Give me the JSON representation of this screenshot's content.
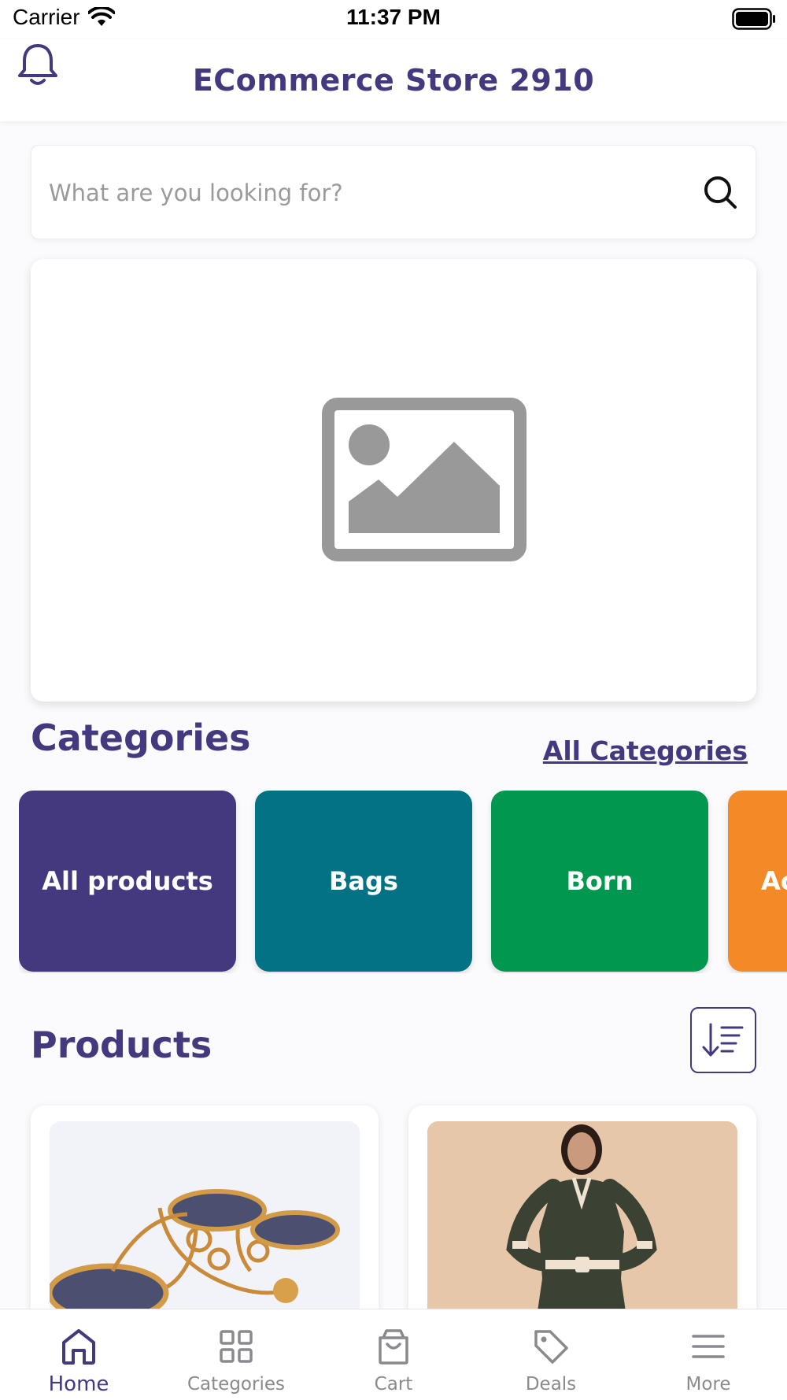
{
  "status_bar": {
    "carrier": "Carrier",
    "time": "11:37 PM"
  },
  "header": {
    "title": "ECommerce Store 2910"
  },
  "search": {
    "placeholder": "What are you looking for?"
  },
  "categories": {
    "title": "Categories",
    "all_link": "All Categories",
    "items": [
      {
        "label": "All products",
        "color": "#44387e"
      },
      {
        "label": "Bags",
        "color": "#027284"
      },
      {
        "label": "Born",
        "color": "#02974f"
      },
      {
        "label": "Ac",
        "color": "#f38a27"
      }
    ]
  },
  "products": {
    "title": "Products"
  },
  "tab_bar": {
    "items": [
      {
        "label": "Home",
        "icon": "home-icon",
        "active": true
      },
      {
        "label": "Categories",
        "icon": "grid-icon"
      },
      {
        "label": "Cart",
        "icon": "bag-icon"
      },
      {
        "label": "Deals",
        "icon": "tag-icon"
      },
      {
        "label": "More",
        "icon": "menu-icon"
      }
    ]
  },
  "colors": {
    "brand": "#44387e",
    "inactive": "#8a8a8e"
  }
}
